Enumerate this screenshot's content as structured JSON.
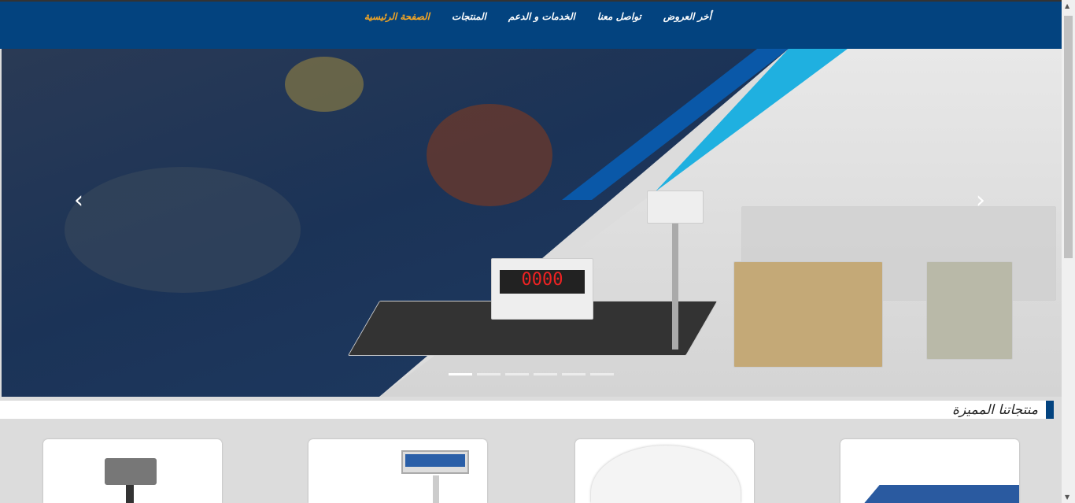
{
  "header": {
    "nav": [
      {
        "label": "الصفحة الرئيسية",
        "active": true
      },
      {
        "label": "المنتجات"
      },
      {
        "label": "الخدمات و الدعم"
      },
      {
        "label": "تواصل معنا"
      },
      {
        "label": "أخر العروض"
      }
    ],
    "accent": "#f5a623",
    "background": "#03437f"
  },
  "slider": {
    "prev_icon": "chevron-left-icon",
    "next_icon": "chevron-right-icon",
    "slides": 6,
    "active": 1,
    "display_text": "0000"
  },
  "featured": {
    "title": "منتجاتنا المميزة"
  }
}
